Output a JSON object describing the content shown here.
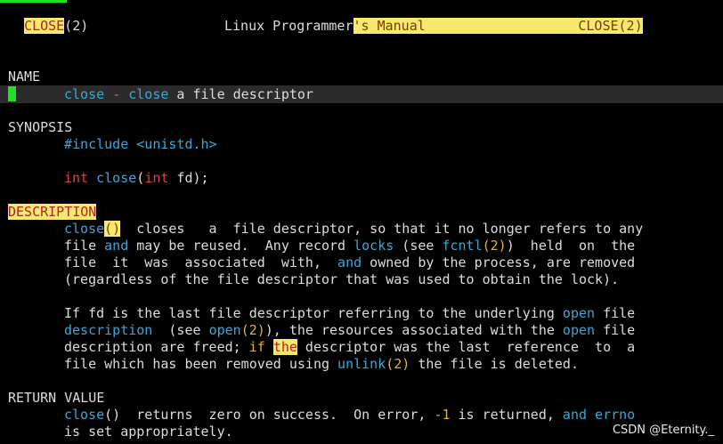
{
  "header": {
    "left_name": "CLOSE",
    "left_sec": "(2)",
    "center_a": "Linux Programmer",
    "center_b": "'s Manual",
    "right": "CLOSE(2)"
  },
  "name_section": {
    "heading": "NAME",
    "fn": "close",
    "dash": "-",
    "fn2": "close",
    "desc": " a file descriptor"
  },
  "synopsis": {
    "heading": "SYNOPSIS",
    "include": "#include <unistd.h>",
    "ret_type": "int",
    "fn": "close",
    "paren_open": "(",
    "arg_type": "int",
    "arg_rest": " fd);"
  },
  "description": {
    "heading": "DESCRIPTION",
    "p1": [
      [
        "close",
        "()",
        "  closes   a  file descriptor, so that it no longer refers to any"
      ],
      [
        "file ",
        "and",
        " may be reused.  Any record ",
        "locks",
        " (see ",
        "fcntl",
        "(2)",
        ")  held  on  the"
      ],
      [
        "file  it  was  associated  with,  ",
        "and",
        " owned by the process, are removed"
      ],
      [
        "(regardless of the file descriptor that was used to obtain the lock)."
      ]
    ],
    "p2": [
      [
        "If fd is the last file descriptor referring to the underlying ",
        "open",
        " file"
      ],
      [
        "description",
        "  (see ",
        "open",
        "(2)",
        "), the resources associated with the ",
        "open",
        " file"
      ],
      [
        "description are freed; ",
        "if",
        " ",
        "the",
        " descriptor was the last  reference  to  a"
      ],
      [
        "file which has been removed using ",
        "unlink",
        "(2)",
        " the file is deleted."
      ]
    ]
  },
  "return_value": {
    "heading": "RETURN VALUE",
    "l1": [
      "close",
      "()  returns  zero on success.  On error, ",
      "-1",
      " is returned, ",
      "and",
      " ",
      "errno"
    ],
    "l2": "is set appropriately."
  },
  "watermark": "CSDN @Eternity._",
  "colors": {
    "background": "#000000",
    "text": "#dcdcdc",
    "keyword_cyan": "#3aa8d8",
    "type_red": "#e04040",
    "number_orange": "#e6b033",
    "search_highlight": "#f7e96b",
    "cursor_green": "#22e022"
  }
}
